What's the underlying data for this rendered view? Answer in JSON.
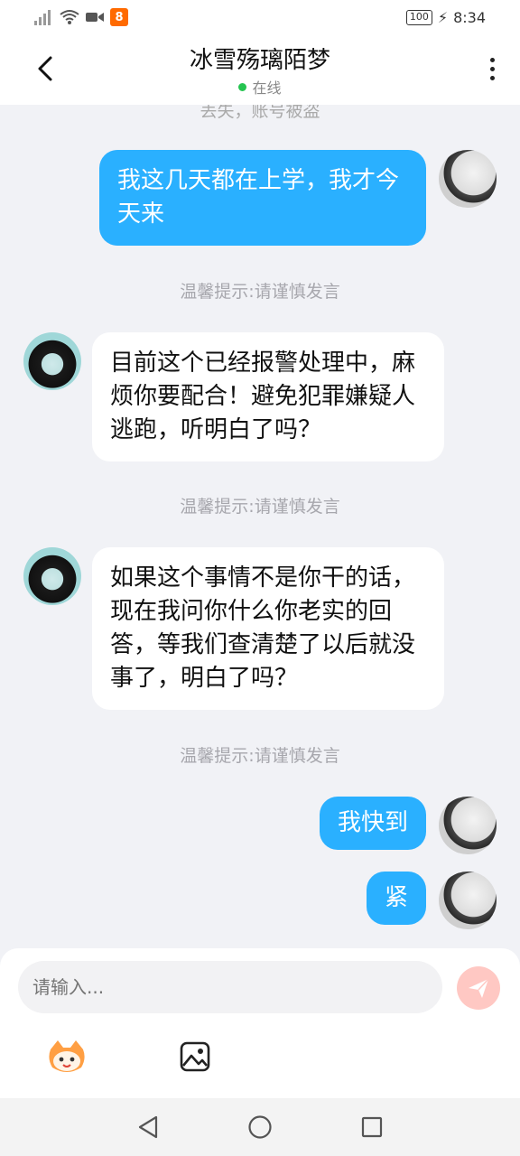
{
  "statusbar": {
    "time": "8:34",
    "battery": "100"
  },
  "header": {
    "title": "冰雪殇璃陌梦",
    "status": "在线"
  },
  "chat": {
    "top_cut": "丢失，账号被盗",
    "tip": "温馨提示:请谨慎发言",
    "messages": [
      {
        "from": "me",
        "text": "我这几天都在上学，我才今天来"
      },
      {
        "from": "them",
        "text": "目前这个已经报警处理中，麻烦你要配合！避免犯罪嫌疑人逃跑，听明白了吗？"
      },
      {
        "from": "them",
        "text": "如果这个事情不是你干的话，现在我问你什么你老实的回答，等我们查清楚了以后就没事了，明白了吗？"
      },
      {
        "from": "me",
        "text": "我快到"
      },
      {
        "from": "me",
        "text": "紧"
      }
    ]
  },
  "input": {
    "placeholder": "请输入..."
  },
  "icons": {
    "back": "chevron-left-icon",
    "more": "more-vertical-icon",
    "send": "send-icon",
    "emoji": "mascot-emoji-icon",
    "image": "image-icon"
  },
  "colors": {
    "accent": "#2ab0ff",
    "online": "#25c450",
    "send_disabled": "#ffc8c3"
  }
}
